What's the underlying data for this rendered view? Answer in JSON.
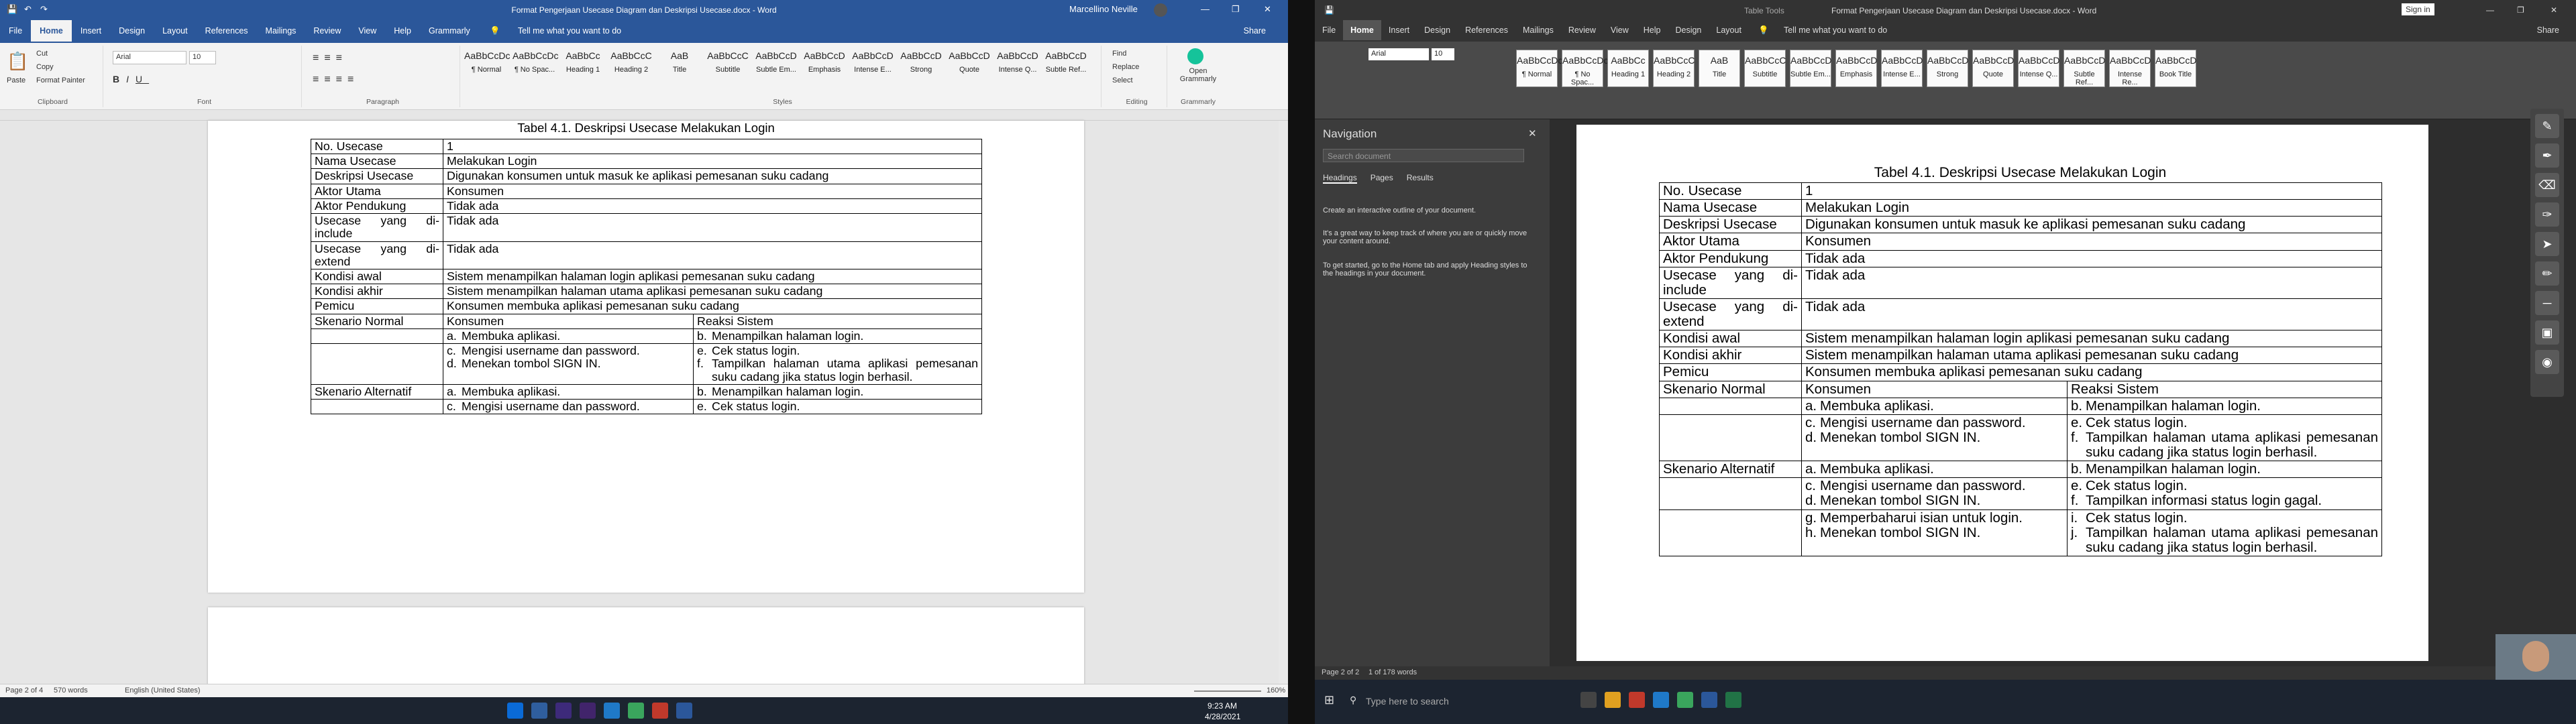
{
  "left": {
    "title": "Format Pengerjaan Usecase Diagram dan Deskripsi Usecase.docx - Word",
    "user": "Marcellino Neville",
    "tabs": [
      "File",
      "Home",
      "Insert",
      "Design",
      "Layout",
      "References",
      "Mailings",
      "Review",
      "View",
      "Help",
      "Grammarly"
    ],
    "tell_me": "Tell me what you want to do",
    "share": "Share",
    "clipboard": {
      "paste": "Paste",
      "cut": "Cut",
      "copy": "Copy",
      "painter": "Format Painter",
      "label": "Clipboard"
    },
    "font": {
      "name": "Arial",
      "size": "10",
      "label": "Font"
    },
    "paragraph_label": "Paragraph",
    "styles": [
      {
        "prev": "AaBbCcDc",
        "name": "¶ Normal"
      },
      {
        "prev": "AaBbCcDc",
        "name": "¶ No Spac..."
      },
      {
        "prev": "AaBbCc",
        "name": "Heading 1"
      },
      {
        "prev": "AaBbCcC",
        "name": "Heading 2"
      },
      {
        "prev": "AaB",
        "name": "Title"
      },
      {
        "prev": "AaBbCcC",
        "name": "Subtitle"
      },
      {
        "prev": "AaBbCcD",
        "name": "Subtle Em..."
      },
      {
        "prev": "AaBbCcD",
        "name": "Emphasis"
      },
      {
        "prev": "AaBbCcD",
        "name": "Intense E..."
      },
      {
        "prev": "AaBbCcD",
        "name": "Strong"
      },
      {
        "prev": "AaBbCcD",
        "name": "Quote"
      },
      {
        "prev": "AaBbCcD",
        "name": "Intense Q..."
      },
      {
        "prev": "AaBbCcD",
        "name": "Subtle Ref..."
      }
    ],
    "styles_label": "Styles",
    "editing": {
      "find": "Find",
      "replace": "Replace",
      "select": "Select",
      "label": "Editing"
    },
    "grammarly": {
      "open": "Open Grammarly",
      "label": "Grammarly"
    },
    "status": {
      "page": "Page 2 of 4",
      "words": "570 words",
      "lang": "English (United States)",
      "zoom": "160%"
    },
    "clock": {
      "time": "9:23 AM",
      "date": "4/28/2021"
    }
  },
  "right": {
    "title": "Format Pengerjaan Usecase Diagram dan Deskripsi Usecase.docx - Word",
    "table_tools": "Table Tools",
    "signin": "Sign in",
    "tabs": [
      "File",
      "Home",
      "Insert",
      "Design",
      "References",
      "Mailings",
      "Review",
      "View",
      "Help",
      "Design",
      "Layout"
    ],
    "tell_me": "Tell me what you want to do",
    "share": "Share",
    "font": {
      "name": "Arial",
      "size": "10"
    },
    "styles": [
      {
        "prev": "AaBbCcDc",
        "name": "¶ Normal"
      },
      {
        "prev": "AaBbCcDc",
        "name": "¶ No Spac..."
      },
      {
        "prev": "AaBbCc",
        "name": "Heading 1"
      },
      {
        "prev": "AaBbCcC",
        "name": "Heading 2"
      },
      {
        "prev": "AaB",
        "name": "Title"
      },
      {
        "prev": "AaBbCcC",
        "name": "Subtitle"
      },
      {
        "prev": "AaBbCcD",
        "name": "Subtle Em..."
      },
      {
        "prev": "AaBbCcD",
        "name": "Emphasis"
      },
      {
        "prev": "AaBbCcD",
        "name": "Intense E..."
      },
      {
        "prev": "AaBbCcD",
        "name": "Strong"
      },
      {
        "prev": "AaBbCcD",
        "name": "Quote"
      },
      {
        "prev": "AaBbCcD",
        "name": "Intense Q..."
      },
      {
        "prev": "AaBbCcD",
        "name": "Subtle Ref..."
      },
      {
        "prev": "AaBbCcD",
        "name": "Intense Re..."
      },
      {
        "prev": "AaBbCcD",
        "name": "Book Title"
      }
    ],
    "nav": {
      "title": "Navigation",
      "search": "Search document",
      "tabs": [
        "Headings",
        "Pages",
        "Results"
      ],
      "info1": "Create an interactive outline of your document.",
      "info2": "It's a great way to keep track of where you are or quickly move your content around.",
      "info3": "To get started, go to the Home tab and apply Heading styles to the headings in your document."
    },
    "status": {
      "page": "Page 2 of 2",
      "words": "1 of 178 words"
    },
    "search_placeholder": "Type here to search"
  },
  "doc_left": {
    "caption": "Tabel 4.1. Deskripsi Usecase Melakukan Login",
    "rows": [
      [
        "No. Usecase",
        "1"
      ],
      [
        "Nama Usecase",
        "Melakukan Login"
      ],
      [
        "Deskripsi Usecase",
        "Digunakan konsumen untuk masuk ke aplikasi pemesanan suku cadang"
      ],
      [
        "Aktor Utama",
        "Konsumen"
      ],
      [
        "Aktor Pendukung",
        "Tidak ada"
      ],
      [
        "Usecase yang di-include",
        "Tidak ada"
      ],
      [
        "Usecase yang di-extend",
        "Tidak ada"
      ],
      [
        "Kondisi awal",
        "Sistem menampilkan halaman login aplikasi pemesanan suku cadang"
      ],
      [
        "Kondisi akhir",
        "Sistem menampilkan halaman utama aplikasi pemesanan suku cadang"
      ],
      [
        "Pemicu",
        "Konsumen membuka aplikasi pemesanan suku cadang"
      ]
    ],
    "normal_label": "Skenario Normal",
    "alt_label": "Skenario Alternatif",
    "col_konsumen": "Konsumen",
    "col_reaksi": "Reaksi Sistem",
    "n1_k": [
      [
        "a.",
        "Membuka aplikasi."
      ]
    ],
    "n1_r": [
      [
        "b.",
        "Menampilkan halaman login."
      ]
    ],
    "n2_k": [
      [
        "c.",
        "Mengisi username dan password."
      ],
      [
        "d.",
        "Menekan tombol SIGN IN."
      ]
    ],
    "n2_r": [
      [
        "e.",
        "Cek status login."
      ],
      [
        "f.",
        "Tampilkan halaman utama aplikasi pemesanan suku cadang jika status login berhasil."
      ]
    ],
    "a1_k": [
      [
        "a.",
        "Membuka aplikasi."
      ]
    ],
    "a1_r": [
      [
        "b.",
        "Menampilkan halaman login."
      ]
    ],
    "a2_k": [
      [
        "c.",
        "Mengisi username dan password."
      ]
    ],
    "a2_r": [
      [
        "e.",
        "Cek status login."
      ]
    ]
  },
  "doc_right": {
    "caption": "Tabel 4.1. Deskripsi Usecase Melakukan Login",
    "rows": [
      [
        "No. Usecase",
        "1"
      ],
      [
        "Nama Usecase",
        "Melakukan Login"
      ],
      [
        "Deskripsi Usecase",
        "Digunakan konsumen untuk masuk ke aplikasi pemesanan suku cadang"
      ],
      [
        "Aktor Utama",
        "Konsumen"
      ],
      [
        "Aktor Pendukung",
        "Tidak ada"
      ],
      [
        "Usecase yang di-include",
        "Tidak ada"
      ],
      [
        "Usecase yang di-extend",
        "Tidak ada"
      ],
      [
        "Kondisi awal",
        "Sistem menampilkan halaman login aplikasi pemesanan suku cadang"
      ],
      [
        "Kondisi akhir",
        "Sistem menampilkan halaman utama aplikasi pemesanan suku cadang"
      ],
      [
        "Pemicu",
        "Konsumen membuka aplikasi pemesanan suku cadang"
      ]
    ],
    "normal_label": "Skenario Normal",
    "alt_label": "Skenario Alternatif",
    "col_konsumen": "Konsumen",
    "col_reaksi": "Reaksi Sistem",
    "n1_k": [
      [
        "a.",
        "Membuka aplikasi."
      ]
    ],
    "n1_r": [
      [
        "b.",
        "Menampilkan halaman login."
      ]
    ],
    "n2_k": [
      [
        "c.",
        "Mengisi username dan password."
      ],
      [
        "d.",
        "Menekan tombol SIGN IN."
      ]
    ],
    "n2_r": [
      [
        "e.",
        "Cek status login."
      ],
      [
        "f.",
        "Tampilkan halaman utama aplikasi pemesanan suku cadang jika status login berhasil."
      ]
    ],
    "a1_k": [
      [
        "a.",
        "Membuka aplikasi."
      ]
    ],
    "a1_r": [
      [
        "b.",
        "Menampilkan halaman login."
      ]
    ],
    "a2_k": [
      [
        "c.",
        "Mengisi username dan password."
      ],
      [
        "d.",
        "Menekan tombol SIGN IN."
      ]
    ],
    "a2_r": [
      [
        "e.",
        "Cek status login."
      ],
      [
        "f.",
        "Tampilkan informasi status login gagal."
      ]
    ],
    "a3_k": [
      [
        "g.",
        "Memperbaharui isian untuk login."
      ],
      [
        "h.",
        "Menekan tombol SIGN IN."
      ]
    ],
    "a3_r": [
      [
        "i.",
        "Cek status login."
      ],
      [
        "j.",
        "Tampilkan halaman utama aplikasi pemesanan suku cadang jika status login berhasil."
      ]
    ]
  },
  "colors": {
    "word_blue": "#2b579a",
    "dark_ui": "#333333",
    "taskbar": "#1c2430"
  }
}
